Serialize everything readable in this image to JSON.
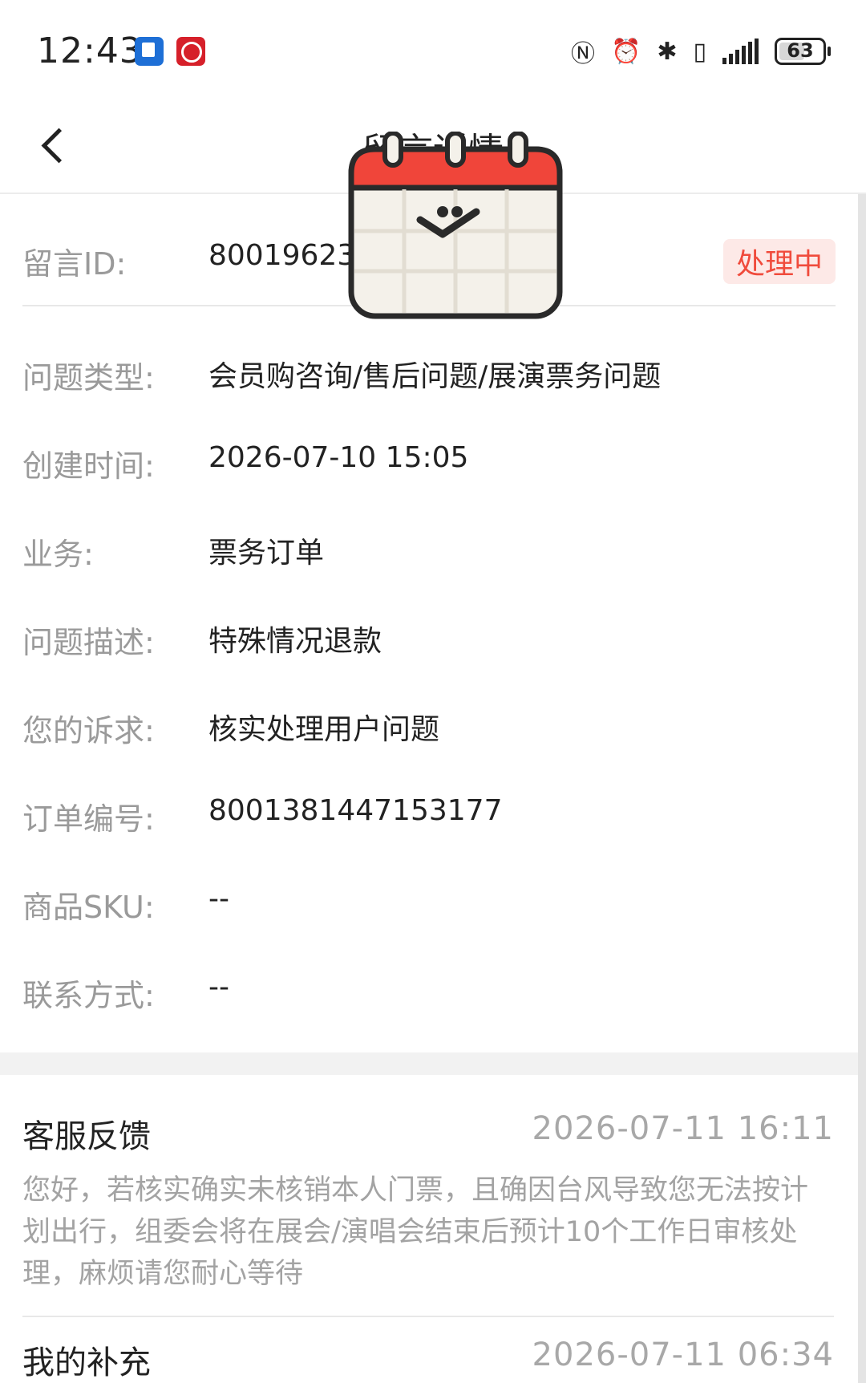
{
  "status_bar": {
    "time": "12:43",
    "battery": "63",
    "battery_level_percent": 63,
    "icons": [
      "nfc-icon",
      "alarm-icon",
      "bluetooth-icon",
      "vibrate-icon",
      "signal-icon",
      "battery-icon"
    ]
  },
  "header": {
    "title": "留言详情"
  },
  "message": {
    "id_label": "留言ID:",
    "id_value": "80019623",
    "status": "处理中",
    "fields": [
      {
        "label": "问题类型:",
        "value": "会员购咨询/售后问题/展演票务问题"
      },
      {
        "label": "创建时间:",
        "value": "2026-07-10 15:05"
      },
      {
        "label": "业务:",
        "value": "票务订单"
      },
      {
        "label": "问题描述:",
        "value": "特殊情况退款"
      },
      {
        "label": "您的诉求:",
        "value": "核实处理用户问题"
      },
      {
        "label": "订单编号:",
        "value": "8001381447153177"
      },
      {
        "label": "商品SKU:",
        "value": "--"
      },
      {
        "label": "联系方式:",
        "value": "--"
      }
    ]
  },
  "feedback": {
    "title": "客服反馈",
    "time": "2026-07-11 16:11",
    "body": "您好，若核实确实未核销本人门票，且确因台风导致您无法按计划出行，组委会将在展会/演唱会结束后预计10个工作日审核处理，麻烦请您耐心等待"
  },
  "supplement": {
    "title": "我的补充",
    "time": "2026-07-11 06:34"
  },
  "colors": {
    "status_badge_bg": "#fde9e7",
    "status_badge_text": "#f04b3c",
    "sticker_red": "#f0453a"
  }
}
